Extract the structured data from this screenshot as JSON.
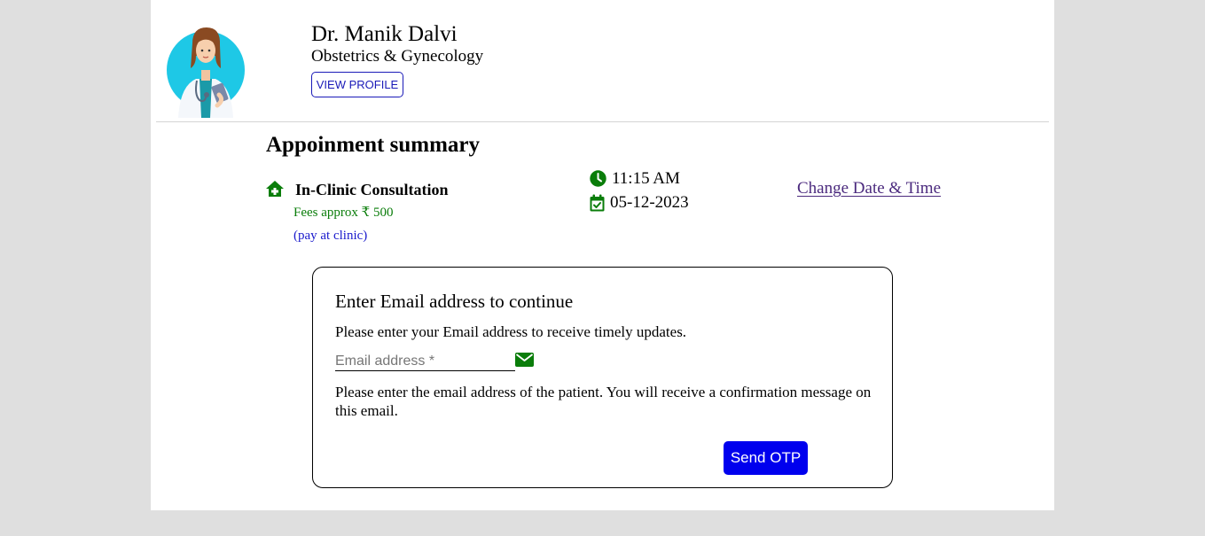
{
  "doctor": {
    "name": "Dr. Manik Dalvi",
    "specialty": "Obstetrics & Gynecology",
    "view_profile_label": "VIEW PROFILE",
    "avatar_icon": "doctor-avatar"
  },
  "summary": {
    "title": "Appoinment summary",
    "consultation_icon": "home-icon",
    "consultation_type": "In-Clinic Consultation",
    "fees": "Fees approx ₹ 500",
    "payment_note": "(pay at clinic)",
    "time_icon": "clock-icon",
    "time": "11:15 AM",
    "date_icon": "calendar-check-icon",
    "date": "05-12-2023",
    "change_link": "Change Date & Time"
  },
  "email_form": {
    "title": "Enter Email address to continue",
    "subtitle": "Please enter your Email address to receive timely updates.",
    "email_value": "",
    "email_placeholder": "Email address *",
    "email_icon": "envelope-icon",
    "note": "Please enter the email address of the patient. You will receive a confirmation message on this email.",
    "submit_label": "Send OTP"
  },
  "colors": {
    "page_background": "#dfdfdf",
    "card_background": "#ffffff",
    "icon_green": "#0a7d0a",
    "fees_green": "#0a7d0a",
    "pay_note_blue": "#1a1acc",
    "link_purple": "#4b2a7e",
    "button_blue": "#0000ee",
    "profile_button_blue": "#1a1ab8"
  }
}
